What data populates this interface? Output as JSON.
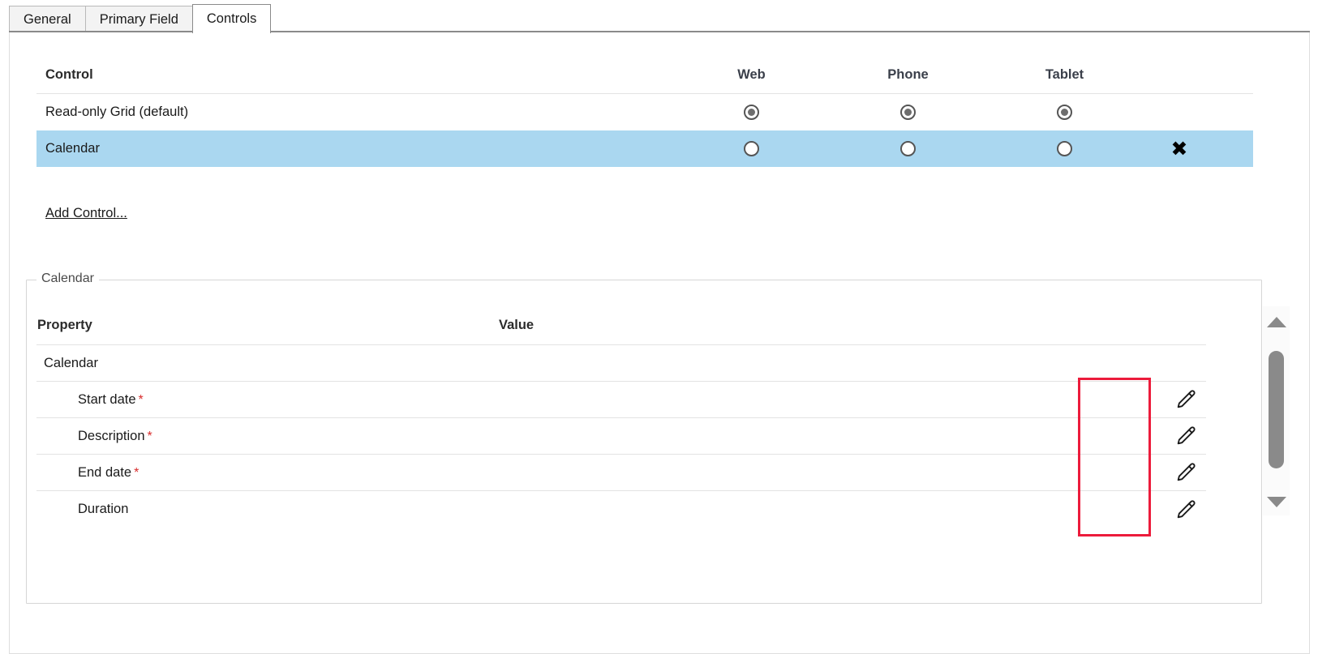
{
  "tabs": [
    {
      "label": "General",
      "active": false
    },
    {
      "label": "Primary Field",
      "active": false
    },
    {
      "label": "Controls",
      "active": true
    }
  ],
  "controls_grid": {
    "headers": {
      "control": "Control",
      "web": "Web",
      "phone": "Phone",
      "tablet": "Tablet"
    },
    "rows": [
      {
        "name": "Read-only Grid (default)",
        "web": "selected",
        "phone": "selected",
        "tablet": "selected",
        "selected": false,
        "removable": false
      },
      {
        "name": "Calendar",
        "web": "unselected",
        "phone": "unselected",
        "tablet": "unselected",
        "selected": true,
        "removable": true,
        "remove_icon": "close-x-icon"
      }
    ],
    "add_control_label": "Add Control..."
  },
  "properties_panel": {
    "legend": "Calendar",
    "headers": {
      "property": "Property",
      "value": "Value"
    },
    "rows": [
      {
        "property": "Calendar",
        "value": "",
        "required": false,
        "indent": 0,
        "editable": false
      },
      {
        "property": "Start date",
        "value": "",
        "required": true,
        "indent": 1,
        "editable": true,
        "edit_icon": "pencil-edit-icon"
      },
      {
        "property": "Description",
        "value": "",
        "required": true,
        "indent": 1,
        "editable": true,
        "edit_icon": "pencil-edit-icon"
      },
      {
        "property": "End date",
        "value": "",
        "required": true,
        "indent": 1,
        "editable": true,
        "edit_icon": "pencil-edit-icon"
      },
      {
        "property": "Duration",
        "value": "",
        "required": false,
        "indent": 1,
        "editable": true,
        "edit_icon": "pencil-edit-icon"
      }
    ],
    "required_marker": "*"
  },
  "scrollbar": {
    "up_icon": "scroll-up-arrow-icon",
    "down_icon": "scroll-down-arrow-icon",
    "thumb": "scrollbar-thumb"
  },
  "annotation": {
    "type": "red-highlight-rectangle",
    "color": "#ec1b3b"
  },
  "colors": {
    "selected_row": "#aad7f0",
    "required_asterisk": "#d82c2c",
    "annotation_red": "#ec1b3b",
    "scrollbar_gray": "#8a8a8a"
  }
}
